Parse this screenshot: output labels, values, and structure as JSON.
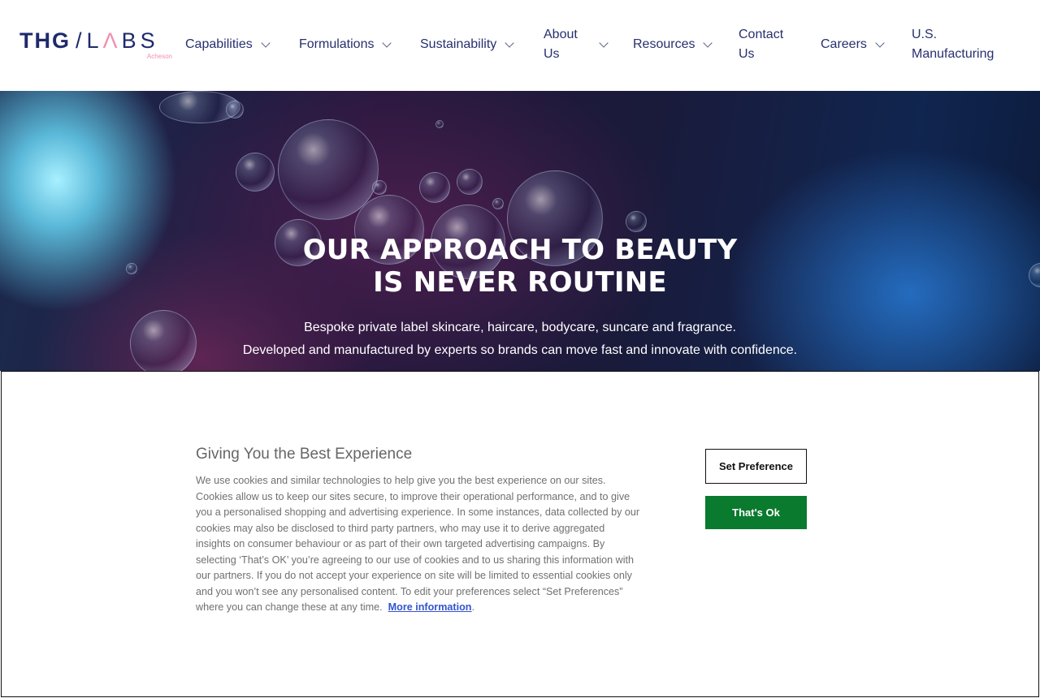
{
  "logo": {
    "thg": "THG",
    "slash": "/",
    "l": "L",
    "a": "Λ",
    "bs": "BS",
    "sub": "Acheson"
  },
  "nav": {
    "items": [
      {
        "label": "Capabilities",
        "has_dropdown": true
      },
      {
        "label": "Formulations",
        "has_dropdown": true
      },
      {
        "label": "Sustainability",
        "has_dropdown": true
      },
      {
        "label": "About Us",
        "has_dropdown": true
      },
      {
        "label": "Resources",
        "has_dropdown": true
      },
      {
        "label": "Contact Us",
        "has_dropdown": false
      },
      {
        "label": "Careers",
        "has_dropdown": true
      },
      {
        "label": "U.S. Manufacturing",
        "has_dropdown": false
      }
    ]
  },
  "hero": {
    "title_line1": "OUR APPROACH TO BEAUTY",
    "title_line2": "IS NEVER ROUTINE",
    "subtitle_line1": "Bespoke private label skincare, haircare, bodycare, suncare and fragrance.",
    "subtitle_line2": "Developed and manufactured by experts so brands can move fast and innovate with confidence."
  },
  "cookie_banner": {
    "title": "Giving You the Best Experience",
    "body": "We use cookies and similar technologies to help give you the best experience on our sites. Cookies allow us to keep our sites secure, to improve their operational performance, and to give you a personalised shopping and advertising experience. In some instances, data collected by our cookies may also be disclosed to third party partners, who may use it to derive aggregated insights on consumer behaviour or as part of their own targeted advertising campaigns. By selecting ‘That’s OK’ you’re agreeing to our use of cookies and to us sharing this information with our partners. If you do not accept your experience on site will be limited to essential cookies only and you won’t see any personalised content. To edit your preferences select “Set Preferences” where you can change these at any time.",
    "link_text": "More information",
    "link_suffix": ".",
    "set_preference_label": "Set Preference",
    "ok_label": "That's Ok"
  },
  "colors": {
    "brand_navy": "#1e2a6b",
    "brand_pink": "#f08fb0",
    "ok_green": "#0a7a2e",
    "link_blue": "#3355cc"
  }
}
